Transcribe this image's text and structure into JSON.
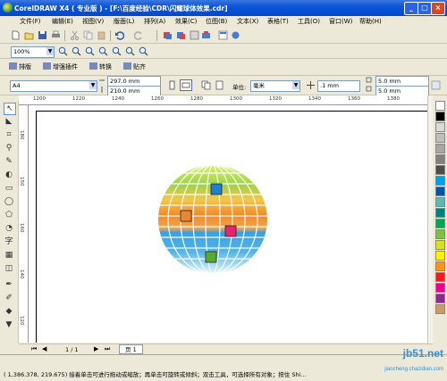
{
  "window": {
    "title": "CorelDRAW X4 ( 专业版 ) - [F:\\百度经验\\CDR\\闪耀球体效果.cdr]",
    "minimize": "_",
    "maximize": "□",
    "close": "×"
  },
  "menu": [
    "文件(F)",
    "编辑(E)",
    "视图(V)",
    "版面(L)",
    "排列(A)",
    "效果(C)",
    "位图(B)",
    "文本(X)",
    "表格(T)",
    "工具(O)",
    "窗口(W)",
    "帮助(H)"
  ],
  "zoom": {
    "value": "100%"
  },
  "secondary_toolbar": {
    "buttons": [
      "排版",
      "增强插件",
      "转换",
      "贴齐"
    ]
  },
  "property_bar": {
    "paper": "A4",
    "width": "297.0 mm",
    "height": "210.0 mm",
    "unit_label": "单位:",
    "unit": "毫米",
    "nudge": ".1 mm",
    "dup_x": "5.0 mm",
    "dup_y": "5.0 mm"
  },
  "hruler": {
    "labels": [
      "1200",
      "1220",
      "1240",
      "1260",
      "1280",
      "1300",
      "1320",
      "1340",
      "1360",
      "1380"
    ]
  },
  "vruler": {
    "labels": [
      "180",
      "150",
      "160",
      "140",
      "120"
    ]
  },
  "pagebar": {
    "page_count": "1 / 1",
    "page_tab": "页 1"
  },
  "statusbar": {
    "text": "( 1,386.378, 219.675) 接着单击可进行拖动或缩放；再单击可旋转或倾斜；双击工具，可选择所有对象；按住 Shi..."
  },
  "watermark": {
    "line1": "jb51.net",
    "line2": "jiaocheng.chazidian.com"
  },
  "palette": {
    "colors": [
      "#ffffff",
      "#000000",
      "#d9d9d9",
      "#bfbfbf",
      "#a6a6a6",
      "#808080",
      "#4d4d4d",
      "#00a0e9",
      "#0055a5",
      "#5cb8b2",
      "#008080",
      "#00a651",
      "#7ac143",
      "#d7df23",
      "#fff200",
      "#f7941d",
      "#ed1c24",
      "#ec008c",
      "#92278f",
      "#c69c6d"
    ]
  },
  "sphere_squares": [
    "#1e7fd0",
    "#e8873a",
    "#e8246f",
    "#5aaa2c"
  ]
}
